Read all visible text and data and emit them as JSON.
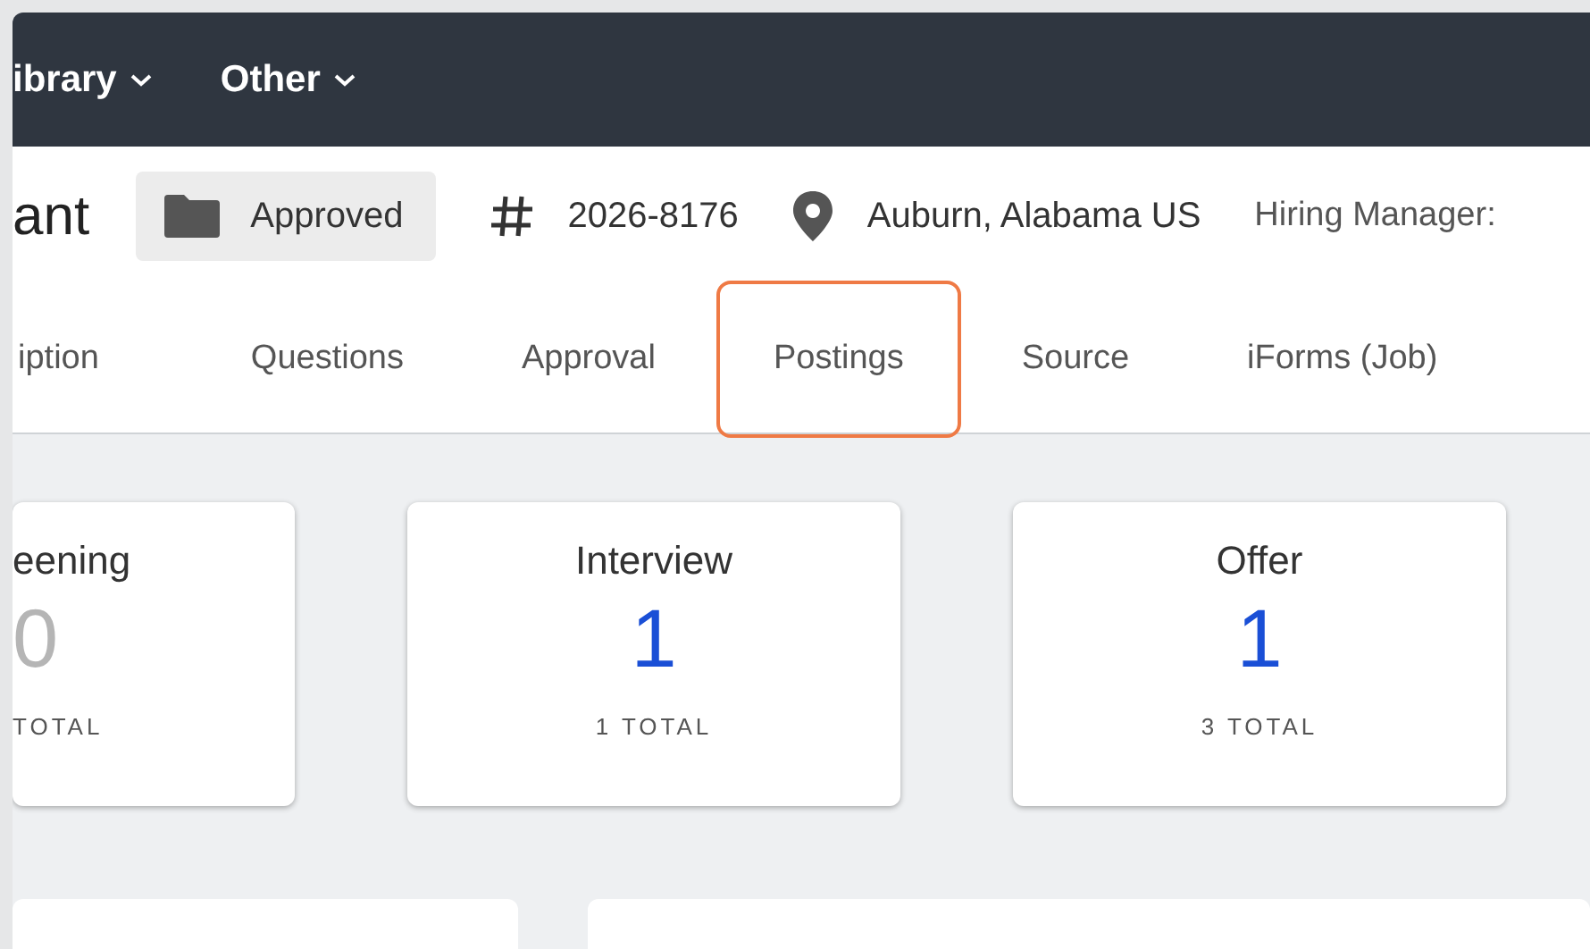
{
  "nav": {
    "menus": [
      {
        "label": "ibrary"
      },
      {
        "label": "Other"
      }
    ]
  },
  "header": {
    "title": "ant",
    "status": "Approved",
    "job_number": "2026-8176",
    "location": "Auburn, Alabama US",
    "hiring_manager_label": "Hiring Manager:"
  },
  "tabs": [
    {
      "label": "iption",
      "selected": false
    },
    {
      "label": "Questions",
      "selected": false
    },
    {
      "label": "Approval",
      "selected": false
    },
    {
      "label": "Postings",
      "selected": true
    },
    {
      "label": "Source",
      "selected": false
    },
    {
      "label": "iForms (Job)",
      "selected": false
    }
  ],
  "stages": [
    {
      "title": "eening",
      "count": "0",
      "total": "TOTAL",
      "color": "#b5b5b5"
    },
    {
      "title": "Interview",
      "count": "1",
      "total": "1 TOTAL",
      "color": "#1a4fd6"
    },
    {
      "title": "Offer",
      "count": "1",
      "total": "3 TOTAL",
      "color": "#1a4fd6"
    }
  ]
}
